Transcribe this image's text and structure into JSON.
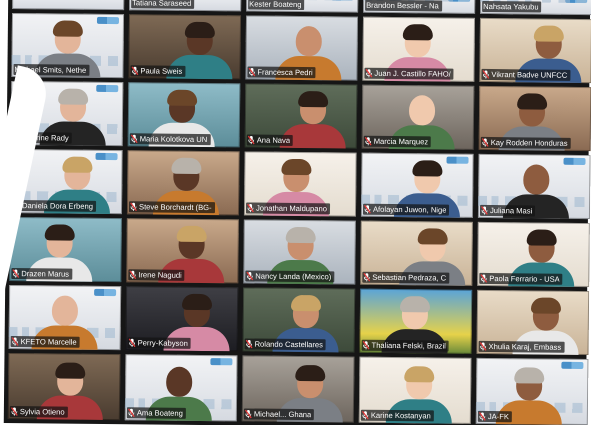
{
  "app": {
    "view": "gallery",
    "accent_muted_icon_color": "#e23b3b",
    "nameplate_background": "#141414",
    "name_text_color": "#ffffff"
  },
  "participants": [
    [
      {
        "name": "",
        "muted": false,
        "bg": "bg-a"
      },
      {
        "name": "Tatiana Saraseed",
        "muted": false,
        "bg": "bg-a"
      },
      {
        "name": "Kester Boateng",
        "muted": false,
        "bg": "bg-a"
      },
      {
        "name": "Brandon Bessler - Na",
        "muted": false,
        "bg": "bg-a"
      },
      {
        "name": "Nahsata Yakubu",
        "muted": false,
        "bg": "bg-a"
      }
    ],
    [
      {
        "name": "Michael Smits, Nethe",
        "muted": false,
        "bg": "bg-a"
      },
      {
        "name": "Paula Sweis",
        "muted": true,
        "bg": "bg-d"
      },
      {
        "name": "Francesca Pedri",
        "muted": true,
        "bg": "bg-c"
      },
      {
        "name": "Juan J. Castillo FAHO/",
        "muted": true,
        "bg": "bg-e"
      },
      {
        "name": "Vikrant Badve UNFCC",
        "muted": true,
        "bg": "bg-b"
      }
    ],
    [
      {
        "name": "Sherine Rady",
        "muted": true,
        "bg": "bg-a"
      },
      {
        "name": "Maria Kolotkova UN",
        "muted": true,
        "bg": "bg-j"
      },
      {
        "name": "Ana Nava",
        "muted": true,
        "bg": "bg-f"
      },
      {
        "name": "Marcia Marquez",
        "muted": true,
        "bg": "bg-l"
      },
      {
        "name": "Kay Rodden Honduras",
        "muted": true,
        "bg": "bg-h"
      }
    ],
    [
      {
        "name": "Daniela Dora Erbeng",
        "muted": true,
        "bg": "bg-a"
      },
      {
        "name": "Steve Borchardt (BG-",
        "muted": true,
        "bg": "bg-h"
      },
      {
        "name": "Jonathan Maldupano",
        "muted": true,
        "bg": "bg-e"
      },
      {
        "name": "Afolayan Juwon, Nige",
        "muted": true,
        "bg": "bg-a"
      },
      {
        "name": "Juliana Masi",
        "muted": true,
        "bg": "bg-a"
      }
    ],
    [
      {
        "name": "Drazen Marus",
        "muted": true,
        "bg": "bg-j"
      },
      {
        "name": "Irene Nagudi",
        "muted": true,
        "bg": "bg-h"
      },
      {
        "name": "Nancy Landa (Mexico)",
        "muted": true,
        "bg": "bg-c"
      },
      {
        "name": "Sebastian Pedraza, C",
        "muted": true,
        "bg": "bg-b"
      },
      {
        "name": "Paola Ferrario - USA",
        "muted": true,
        "bg": "bg-e"
      }
    ],
    [
      {
        "name": "KFETO Marcelle",
        "muted": true,
        "bg": "bg-a"
      },
      {
        "name": "Perry-Kabyson",
        "muted": true,
        "bg": "bg-k"
      },
      {
        "name": "Rolando Castellares",
        "muted": true,
        "bg": "bg-f"
      },
      {
        "name": "Thaliana Felski, Brazil",
        "muted": true,
        "bg": "bg-i"
      },
      {
        "name": "Xhulia Karaj, Embass",
        "muted": true,
        "bg": "bg-b"
      }
    ],
    [
      {
        "name": "Sylvia Otieno",
        "muted": true,
        "bg": "bg-d"
      },
      {
        "name": "Ama Boateng",
        "muted": true,
        "bg": "bg-a"
      },
      {
        "name": "Michael... Ghana",
        "muted": true,
        "bg": "bg-l"
      },
      {
        "name": "Karine Kostanyan",
        "muted": true,
        "bg": "bg-e"
      },
      {
        "name": "JA-FK",
        "muted": true,
        "bg": "bg-a"
      }
    ]
  ],
  "icons": {
    "muted_mic": "muted-mic-icon",
    "background_logo": "unfccc-logo-icon"
  }
}
